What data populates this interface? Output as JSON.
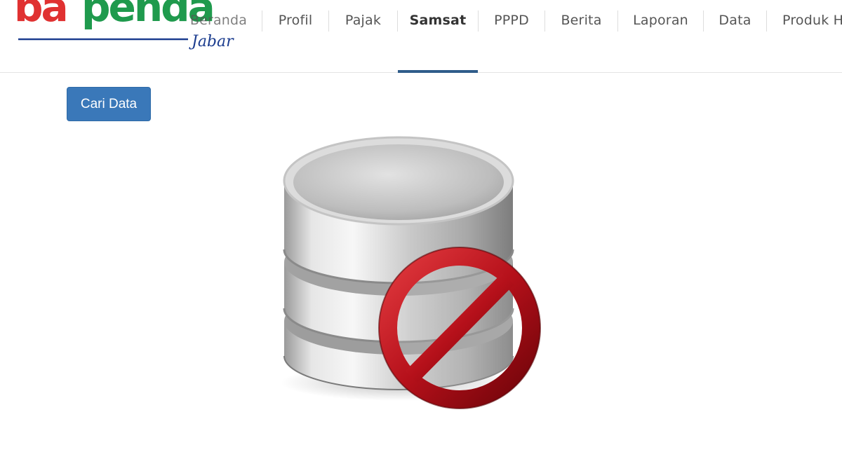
{
  "header": {
    "logo": {
      "brand": "bapenda",
      "sub": "Jabar",
      "colors": {
        "red": "#e03131",
        "green": "#1f9a4d",
        "blue": "#1c3d8f"
      }
    },
    "nav": [
      {
        "label": "Beranda",
        "active": false
      },
      {
        "label": "Profil",
        "active": false
      },
      {
        "label": "Pajak",
        "active": false
      },
      {
        "label": "Samsat",
        "active": true
      },
      {
        "label": "PPPD",
        "active": false
      },
      {
        "label": "Berita",
        "active": false
      },
      {
        "label": "Laporan",
        "active": false
      },
      {
        "label": "Data",
        "active": false
      },
      {
        "label": "Produk H",
        "active": false
      }
    ],
    "active_indicator_color": "#2f5c8a"
  },
  "main": {
    "search_button": {
      "label": "Cari Data",
      "color": "#3a78b9"
    },
    "illustration": {
      "icon": "database-unavailable-icon",
      "prohibit_color": "#c0121c"
    }
  }
}
